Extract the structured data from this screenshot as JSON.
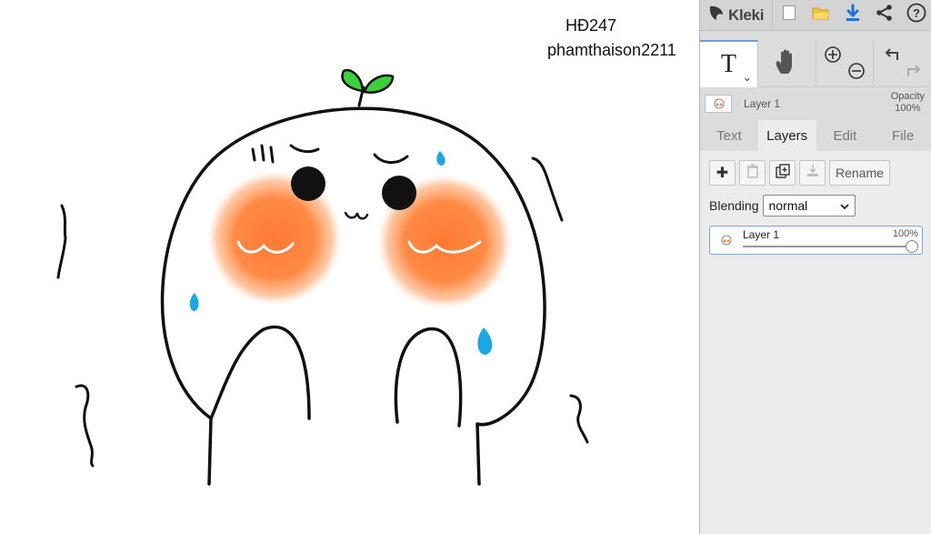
{
  "app": {
    "name": "Kleki",
    "colors": {
      "accent": "#6f9fd8",
      "sidebar_bg": "#dcdcdc",
      "panel_bg": "#ececec"
    }
  },
  "toolbar": {
    "icons": [
      "kleki-logo-icon",
      "new-image-icon",
      "open-folder-icon",
      "download-icon",
      "share-icon",
      "help-icon"
    ]
  },
  "tools": {
    "text_tool_label": "T",
    "caret": "⌄",
    "icons": [
      "text-tool-icon",
      "hand-tool-icon",
      "zoom-in-icon",
      "zoom-out-icon",
      "undo-icon",
      "redo-icon"
    ]
  },
  "layer_summary": {
    "name": "Layer 1",
    "opacity_label": "Opacity",
    "opacity_value": "100%"
  },
  "tabs": [
    {
      "label": "Text"
    },
    {
      "label": "Layers"
    },
    {
      "label": "Edit"
    },
    {
      "label": "File"
    }
  ],
  "layers_panel": {
    "add_label": "✚",
    "rename_label": "Rename",
    "blending_label": "Blending",
    "blending_value": "normal",
    "layers": [
      {
        "name": "Layer 1",
        "opacity_text": "100%",
        "opacity": 1.0
      }
    ]
  },
  "canvas": {
    "text_lines": [
      "HĐ247",
      "phamthaison2211"
    ]
  }
}
